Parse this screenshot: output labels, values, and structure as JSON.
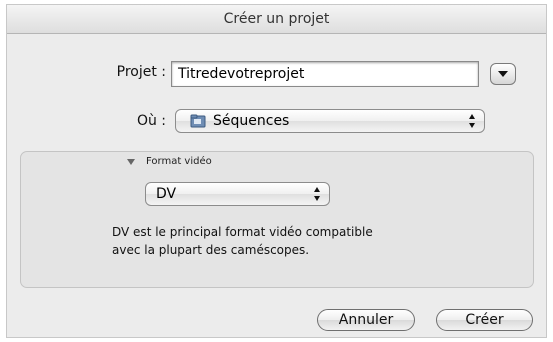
{
  "window": {
    "title": "Créer un projet"
  },
  "form": {
    "projet_label": "Projet :",
    "projet_value": "Titredevotreprojet",
    "ou_label": "Où :",
    "ou_value": "Séquences"
  },
  "format": {
    "section_label": "Format vidéo",
    "selected": "DV",
    "description_lines": [
      "DV est le principal format vidéo compatible",
      "avec la plupart des caméscopes."
    ]
  },
  "buttons": {
    "cancel": "Annuler",
    "create": "Créer"
  },
  "icons": {
    "disclosure": "down-triangle-icon",
    "folder": "folder-icon",
    "popup_arrows": "updown-arrows-icon",
    "section_toggle": "disclosure-triangle-icon"
  }
}
